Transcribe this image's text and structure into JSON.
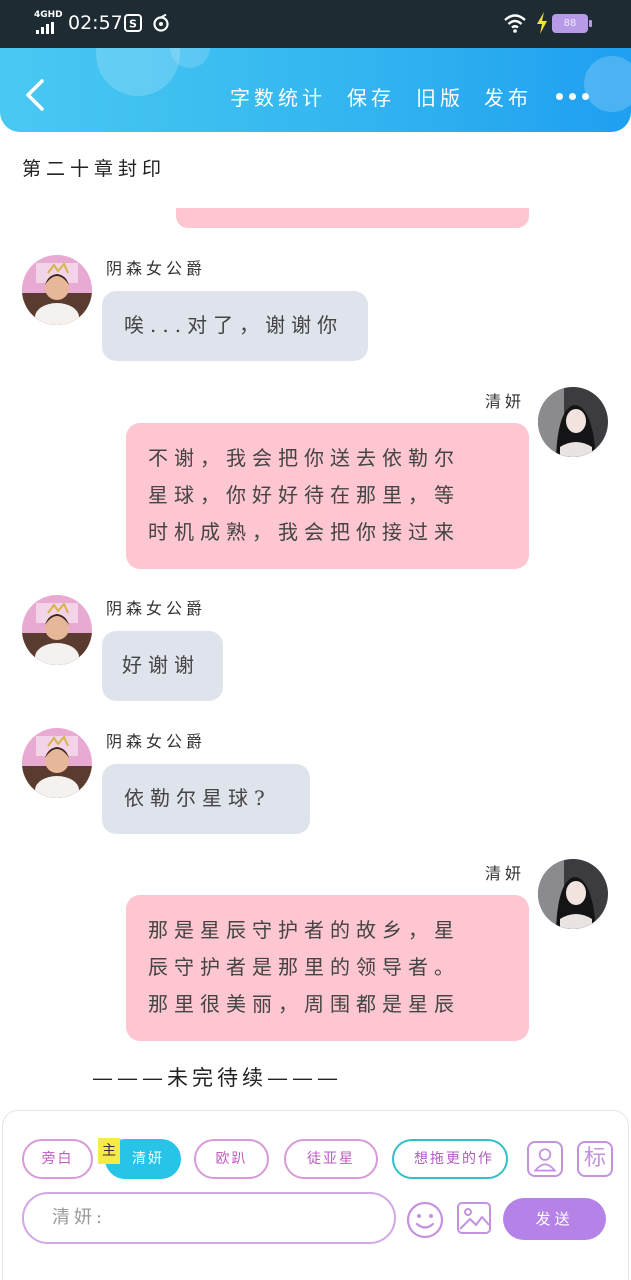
{
  "status_bar": {
    "network": "4GHD",
    "time": "02:57",
    "battery": "88"
  },
  "header": {
    "actions": [
      "字数统计",
      "保存",
      "旧版",
      "发布"
    ]
  },
  "chapter_title": "第二十章封印",
  "messages": [
    {
      "side": "left",
      "name": "阴森女公爵",
      "lines": [
        "唉...对了，谢谢你"
      ]
    },
    {
      "side": "right",
      "name": "清妍",
      "lines": [
        "不谢，我会把你送去依勒尔",
        "星球，你好好待在那里，等",
        "时机成熟，我会把你接过来"
      ]
    },
    {
      "side": "left",
      "name": "阴森女公爵",
      "lines": [
        "好谢谢"
      ]
    },
    {
      "side": "left",
      "name": "阴森女公爵",
      "lines": [
        "依勒尔星球?"
      ]
    },
    {
      "side": "right",
      "name": "清妍",
      "lines": [
        "那是星辰守护者的故乡，星",
        "辰守护者是那里的领导者。",
        "那里很美丽，周围都是星辰"
      ]
    }
  ],
  "to_be_continued": "———未完待续———",
  "roles": {
    "main_mark": "主",
    "chips": [
      "旁白",
      "清妍",
      "欧趴",
      "徒亚星",
      "想拖更的作"
    ],
    "selected_index": 1
  },
  "composer": {
    "input_placeholder": "清妍:",
    "send_label": "发送",
    "tag_label": "标"
  },
  "colors": {
    "header_gradient": [
      "#49c9f2",
      "#1f9ff0"
    ],
    "left_bubble": "#dfe4ec",
    "right_bubble": "#fdc6d1",
    "send_button": "#b582e8",
    "active_chip": "#27c4e8"
  }
}
